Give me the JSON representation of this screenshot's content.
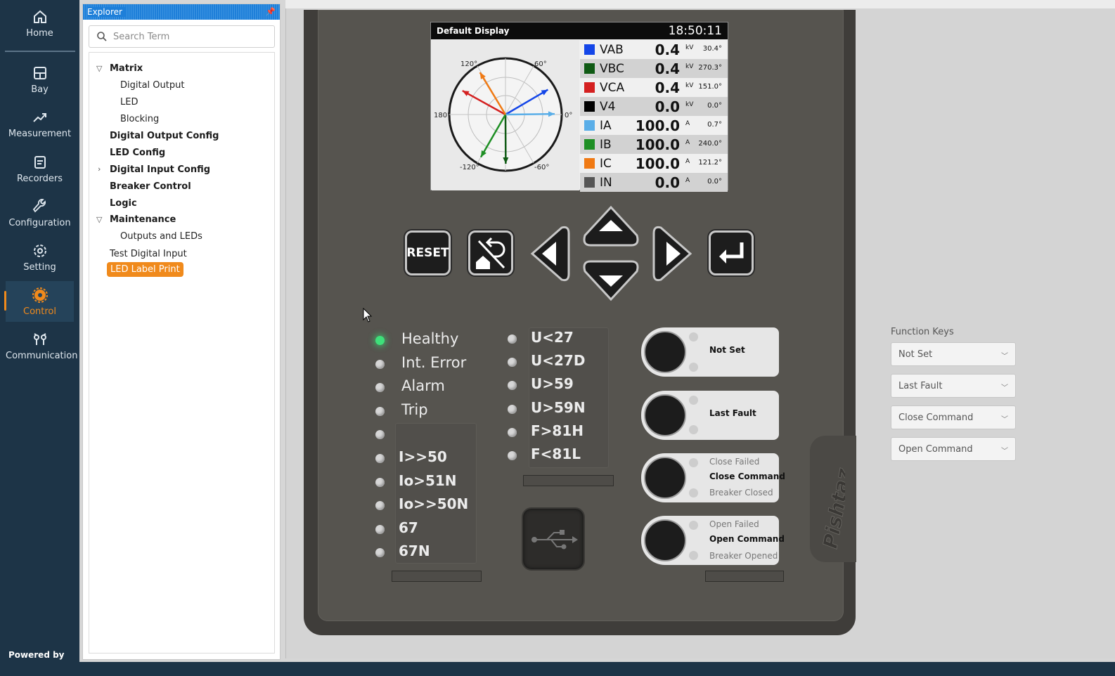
{
  "nav": {
    "items": [
      {
        "label": "Home",
        "icon": "home-icon"
      },
      {
        "label": "Bay",
        "icon": "grid-icon"
      },
      {
        "label": "Measurement",
        "icon": "trend-icon"
      },
      {
        "label": "Recorders",
        "icon": "list-icon"
      },
      {
        "label": "Configuration",
        "icon": "wrench-icon"
      },
      {
        "label": "Setting",
        "icon": "gear-icon"
      },
      {
        "label": "Control",
        "icon": "control-gear-icon",
        "active": true
      },
      {
        "label": "Communication",
        "icon": "communication-icon"
      }
    ],
    "powered_by": "Powered by"
  },
  "explorer": {
    "title": "Explorer",
    "search_placeholder": "Search Term",
    "tree": [
      {
        "label": "Matrix",
        "level": 0,
        "bold": true,
        "expanded": true
      },
      {
        "label": "Digital Output",
        "level": 1
      },
      {
        "label": "LED",
        "level": 1
      },
      {
        "label": "Blocking",
        "level": 1
      },
      {
        "label": "Digital Output Config",
        "level": 0,
        "bold": true
      },
      {
        "label": "LED Config",
        "level": 0,
        "bold": true
      },
      {
        "label": "Digital Input Config",
        "level": 0,
        "bold": true,
        "expanded": false
      },
      {
        "label": "Breaker Control",
        "level": 0,
        "bold": true
      },
      {
        "label": "Logic",
        "level": 0,
        "bold": true
      },
      {
        "label": "Maintenance",
        "level": 0,
        "bold": true,
        "expanded": true
      },
      {
        "label": "Outputs and LEDs",
        "level": 1
      },
      {
        "label": "Test Digital Input",
        "level": 0
      },
      {
        "label": "LED Label Print",
        "level": 0,
        "selected": true
      }
    ]
  },
  "display": {
    "title": "Default Display",
    "time": "18:50:11",
    "phasor_labels": [
      "120°",
      "60°",
      "180°",
      "0°",
      "-120°",
      "-60°"
    ],
    "measurements": [
      {
        "name": "VAB",
        "value": "0.4",
        "unit": "kV",
        "angle": "30.4°",
        "color": "#1446e8"
      },
      {
        "name": "VBC",
        "value": "0.4",
        "unit": "kV",
        "angle": "270.3°",
        "color": "#0f5a14"
      },
      {
        "name": "VCA",
        "value": "0.4",
        "unit": "kV",
        "angle": "151.0°",
        "color": "#d42020"
      },
      {
        "name": "V4",
        "value": "0.0",
        "unit": "kV",
        "angle": "0.0°",
        "color": "#000000"
      },
      {
        "name": "IA",
        "value": "100.0",
        "unit": "A",
        "angle": "0.7°",
        "color": "#5aaee8"
      },
      {
        "name": "IB",
        "value": "100.0",
        "unit": "A",
        "angle": "240.0°",
        "color": "#1e8f24"
      },
      {
        "name": "IC",
        "value": "100.0",
        "unit": "A",
        "angle": "121.2°",
        "color": "#f07a14"
      },
      {
        "name": "IN",
        "value": "0.0",
        "unit": "A",
        "angle": "0.0°",
        "color": "#555555"
      }
    ]
  },
  "keys": {
    "reset": "RESET"
  },
  "leds_left": [
    "Healthy",
    "Int. Error",
    "Alarm",
    "Trip",
    "",
    "I>>50",
    "Io>51N",
    "Io>>50N",
    "67",
    "67N"
  ],
  "leds_mid": [
    "U<27",
    "U<27D",
    "U>59",
    "U>59N",
    "F>81H",
    "F<81L"
  ],
  "device_fkeys": [
    {
      "labels": [
        "Not Set"
      ]
    },
    {
      "labels": [
        "Last Fault"
      ]
    },
    {
      "labels": [
        "Close Failed",
        "Close Command",
        "Breaker Closed"
      ]
    },
    {
      "labels": [
        "Open Failed",
        "Open Command",
        "Breaker Opened"
      ]
    }
  ],
  "brand": "Pishtaz",
  "function_keys": {
    "title": "Function Keys",
    "options": [
      "Not Set",
      "Last Fault",
      "Close Command",
      "Open Command"
    ]
  }
}
